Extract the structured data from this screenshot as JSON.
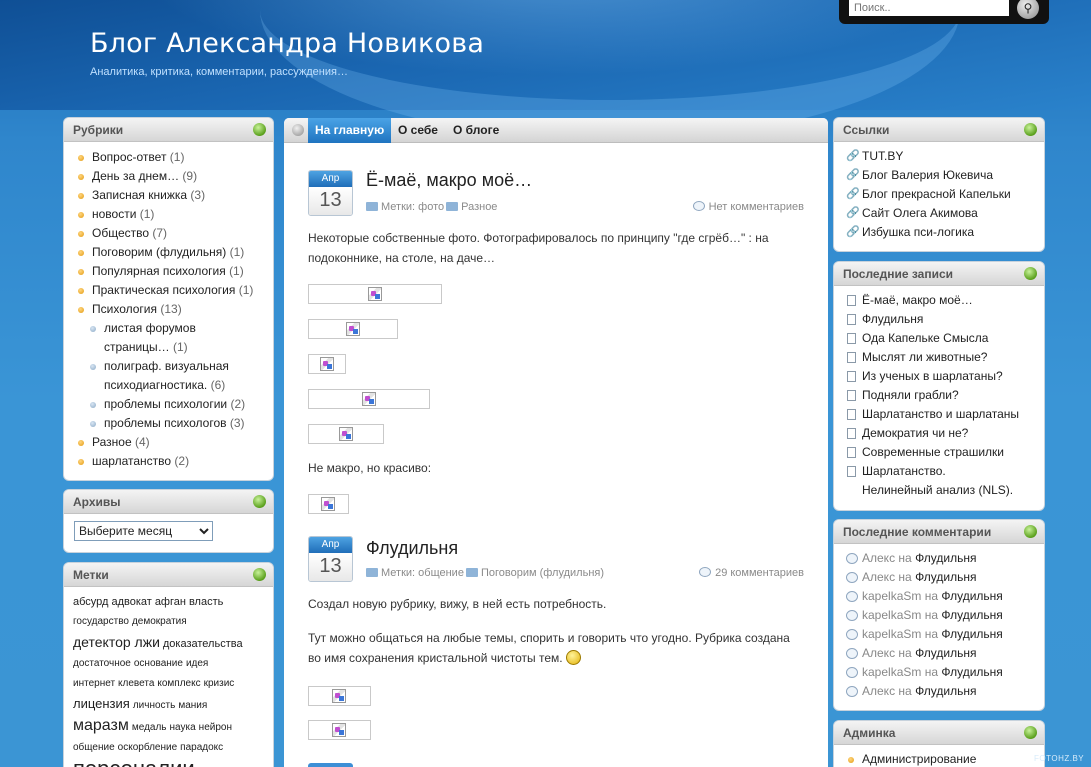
{
  "header": {
    "title": "Блог Александра Новикова",
    "tagline": "Аналитика, критика, комментарии, рассуждения…",
    "search_placeholder": "Поиск..",
    "search_icon": "magnifier-icon"
  },
  "nav": {
    "items": [
      {
        "label": "На главную"
      },
      {
        "label": "О себе"
      },
      {
        "label": "О блоге"
      }
    ]
  },
  "rubrics": {
    "title": "Рубрики",
    "items": [
      {
        "label": "Вопрос-ответ",
        "count": "(1)"
      },
      {
        "label": "День за днем…",
        "count": "(9)"
      },
      {
        "label": "Записная книжка",
        "count": "(3)"
      },
      {
        "label": "новости",
        "count": "(1)"
      },
      {
        "label": "Общество",
        "count": "(7)"
      },
      {
        "label": "Поговорим (флудильня)",
        "count": "(1)"
      },
      {
        "label": "Популярная психология",
        "count": "(1)"
      },
      {
        "label": "Практическая психология",
        "count": "(1)"
      },
      {
        "label": "Психология",
        "count": "(13)"
      },
      {
        "label": "листая форумов страницы…",
        "count": "(1)"
      },
      {
        "label": "полиграф. визуальная психодиагностика.",
        "count": "(6)"
      },
      {
        "label": "проблемы психологии",
        "count": "(2)"
      },
      {
        "label": "проблемы психологов",
        "count": "(3)"
      },
      {
        "label": "Разное",
        "count": "(4)"
      },
      {
        "label": "шарлатанство",
        "count": "(2)"
      }
    ]
  },
  "archives": {
    "title": "Архивы",
    "select_value": "Выберите месяц"
  },
  "tags": {
    "title": "Метки",
    "line1": [
      "абсурд",
      "адвокат",
      "афган",
      "власть"
    ],
    "line2": [
      "государство",
      "демократия"
    ],
    "line3_big": "детектор лжи",
    "line3_small": "доказательства",
    "line4": [
      "достаточное",
      "основание",
      "идея"
    ],
    "line5": [
      "интернет",
      "клевета",
      "комплекс",
      "кризис"
    ],
    "line6_big": "лицензия",
    "line6_small": [
      "личность",
      "мания"
    ],
    "line7_big": "маразм",
    "line7_small": [
      "медаль",
      "наука",
      "нейрон"
    ],
    "line8": [
      "общение",
      "оскорбление",
      "парадокс"
    ],
    "line9_big": "персоналии"
  },
  "links": {
    "title": "Ссылки",
    "items": [
      "TUT.BY",
      "Блог Валерия Юкевича",
      "Блог прекрасной Капельки",
      "Сайт Олега Акимова",
      "Избушка пси-логика"
    ]
  },
  "recent_posts": {
    "title": "Последние записи",
    "items": [
      "Ё-маё, макро моё…",
      "Флудильня",
      "Ода Капельке Смысла",
      "Мыслят ли животные?",
      "Из ученых в шарлатаны?",
      "Подняли грабли?",
      "Шарлатанство и шарлатаны",
      "Демократия чи не?",
      "Современные страшилки",
      "Шарлатанство. Нелинейный анализ (NLS)."
    ]
  },
  "recent_comments": {
    "title": "Последние комментарии",
    "on_word": "на",
    "items": [
      {
        "author": "Алекс",
        "post": "Флудильня"
      },
      {
        "author": "Алекс",
        "post": "Флудильня"
      },
      {
        "author": "kapelkaSm",
        "post": "Флудильня"
      },
      {
        "author": "kapelkaSm",
        "post": "Флудильня"
      },
      {
        "author": "kapelkaSm",
        "post": "Флудильня"
      },
      {
        "author": "Алекс",
        "post": "Флудильня"
      },
      {
        "author": "kapelkaSm",
        "post": "Флудильня"
      },
      {
        "author": "Алекс",
        "post": "Флудильня"
      }
    ]
  },
  "admin": {
    "title": "Админка",
    "items": [
      "Администрирование"
    ]
  },
  "posts": [
    {
      "month": "Апр",
      "day": "13",
      "title": "Ё-маё, макро моё…",
      "tags_label": "Метки: фото",
      "category": "Разное",
      "comments": "Нет комментариев",
      "text1": "Некоторые собственные фото. Фотографировалось по принципу \"где сгрёб…\" : на подоконнике, на столе, на даче…",
      "text2": "Не макро, но красиво:"
    },
    {
      "month": "Апр",
      "day": "13",
      "title": "Флудильня",
      "tags_label": "Метки: общение",
      "category": "Поговорим (флудильня)",
      "comments": "29 комментариев",
      "text1": "Создал новую рубрику, вижу, в ней есть потребность.",
      "text2": "Тут можно общаться на любые темы, спорить и говорить что угодно. Рубрика создана во имя сохранения кристальной чистоты тем."
    }
  ],
  "watermark": "FOTOHZ.BY"
}
